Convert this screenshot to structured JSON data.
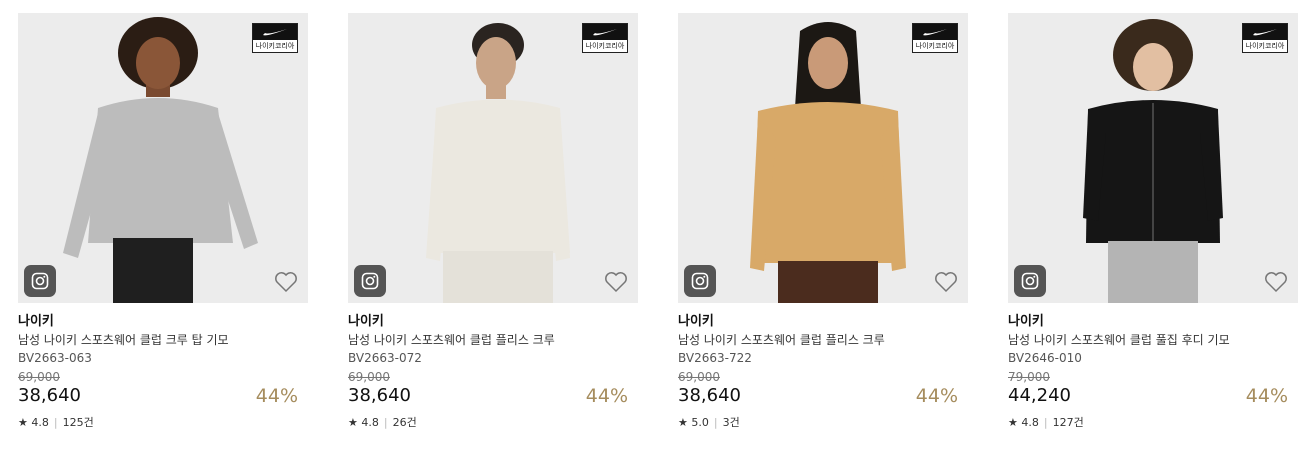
{
  "badge_label": "나이키코리아",
  "accent": "#a58c5d",
  "products": [
    {
      "brand": "나이키",
      "name": "남성 나이키 스포츠웨어 클럽 크루 탑 기모",
      "code": "BV2663-063",
      "original_price": "69,000",
      "price": "38,640",
      "discount": "44%",
      "rating": "4.8",
      "reviews": "125건",
      "sweater_color": "#bcbcbc"
    },
    {
      "brand": "나이키",
      "name": "남성 나이키 스포츠웨어 클럽 플리스 크루",
      "code": "BV2663-072",
      "original_price": "69,000",
      "price": "38,640",
      "discount": "44%",
      "rating": "4.8",
      "reviews": "26건",
      "sweater_color": "#ebe8e0"
    },
    {
      "brand": "나이키",
      "name": "남성 나이키 스포츠웨어 클럽 플리스 크루",
      "code": "BV2663-722",
      "original_price": "69,000",
      "price": "38,640",
      "discount": "44%",
      "rating": "5.0",
      "reviews": "3건",
      "sweater_color": "#d8a968"
    },
    {
      "brand": "나이키",
      "name": "남성 나이키 스포츠웨어 클럽 풀집 후디 기모",
      "code": "BV2646-010",
      "original_price": "79,000",
      "price": "44,240",
      "discount": "44%",
      "rating": "4.8",
      "reviews": "127건",
      "sweater_color": "#151515"
    }
  ]
}
